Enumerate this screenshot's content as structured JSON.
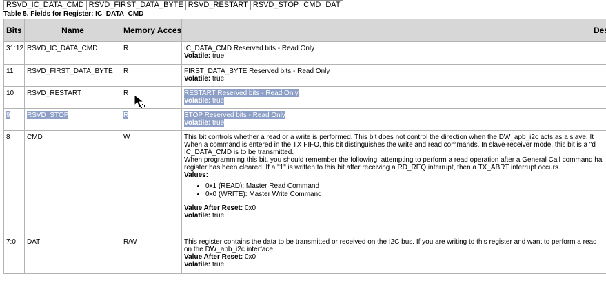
{
  "fields_bar": [
    "RSVD_IC_DATA_CMD",
    "RSVD_FIRST_DATA_BYTE",
    "RSVD_RESTART",
    "RSVD_STOP",
    "CMD",
    "DAT"
  ],
  "caption": "Table 5. Fields for Register: IC_DATA_CMD",
  "headers": {
    "bits": "Bits",
    "name": "Name",
    "access": "Memory Access",
    "description": "Descrip"
  },
  "rows": [
    {
      "bits": "31:12",
      "name": "RSVD_IC_DATA_CMD",
      "access": "R",
      "line1": "IC_DATA_CMD Reserved bits - Read Only",
      "volatile_label": "Volatile:",
      "volatile_value": "true"
    },
    {
      "bits": "11",
      "name": "RSVD_FIRST_DATA_BYTE",
      "access": "R",
      "line1": "FIRST_DATA_BYTE Reserved bits - Read Only",
      "volatile_label": "Volatile:",
      "volatile_value": "true"
    },
    {
      "bits": "10",
      "name": "RSVD_RESTART",
      "access": "R",
      "line1": "RESTART Reserved bits - Read Only",
      "volatile_label": "Volatile:",
      "volatile_value": "true"
    },
    {
      "bits": "9",
      "name": "RSVD_STOP",
      "access": "R",
      "line1": "STOP Reserved bits - Read Only",
      "volatile_label": "Volatile:",
      "volatile_value": "true"
    },
    {
      "bits": "8",
      "name": "CMD",
      "access": "W",
      "text_lines": [
        "This bit controls whether a read or a write is performed. This bit does not control the direction when the DW_apb_i2c acts as a slave. It",
        "When a command is entered in the TX FIFO, this bit distinguishes the write and read commands. In slave-receiver mode, this bit is a \"d",
        "IC_DATA_CMD is to be transmitted.",
        "When programming this bit, you should remember the following: attempting to perform a read operation after a General Call command ha",
        "register has been cleared. If a \"1\" is written to this bit after receiving a RD_REQ interrupt, then a TX_ABRT interrupt occurs."
      ],
      "values_label": "Values:",
      "values": [
        "0x1 (READ): Master Read Command",
        "0x0 (WRITE): Master Write Command"
      ],
      "reset_label": "Value After Reset:",
      "reset_value": "0x0",
      "volatile_label": "Volatile:",
      "volatile_value": "true"
    },
    {
      "bits": "7:0",
      "name": "DAT",
      "access": "R/W",
      "text_lines": [
        "This register contains the data to be transmitted or received on the I2C bus. If you are writing to this register and want to perform a read",
        "on the DW_apb_i2c interface."
      ],
      "reset_label": "Value After Reset:",
      "reset_value": "0x0",
      "volatile_label": "Volatile:",
      "volatile_value": "true"
    }
  ]
}
